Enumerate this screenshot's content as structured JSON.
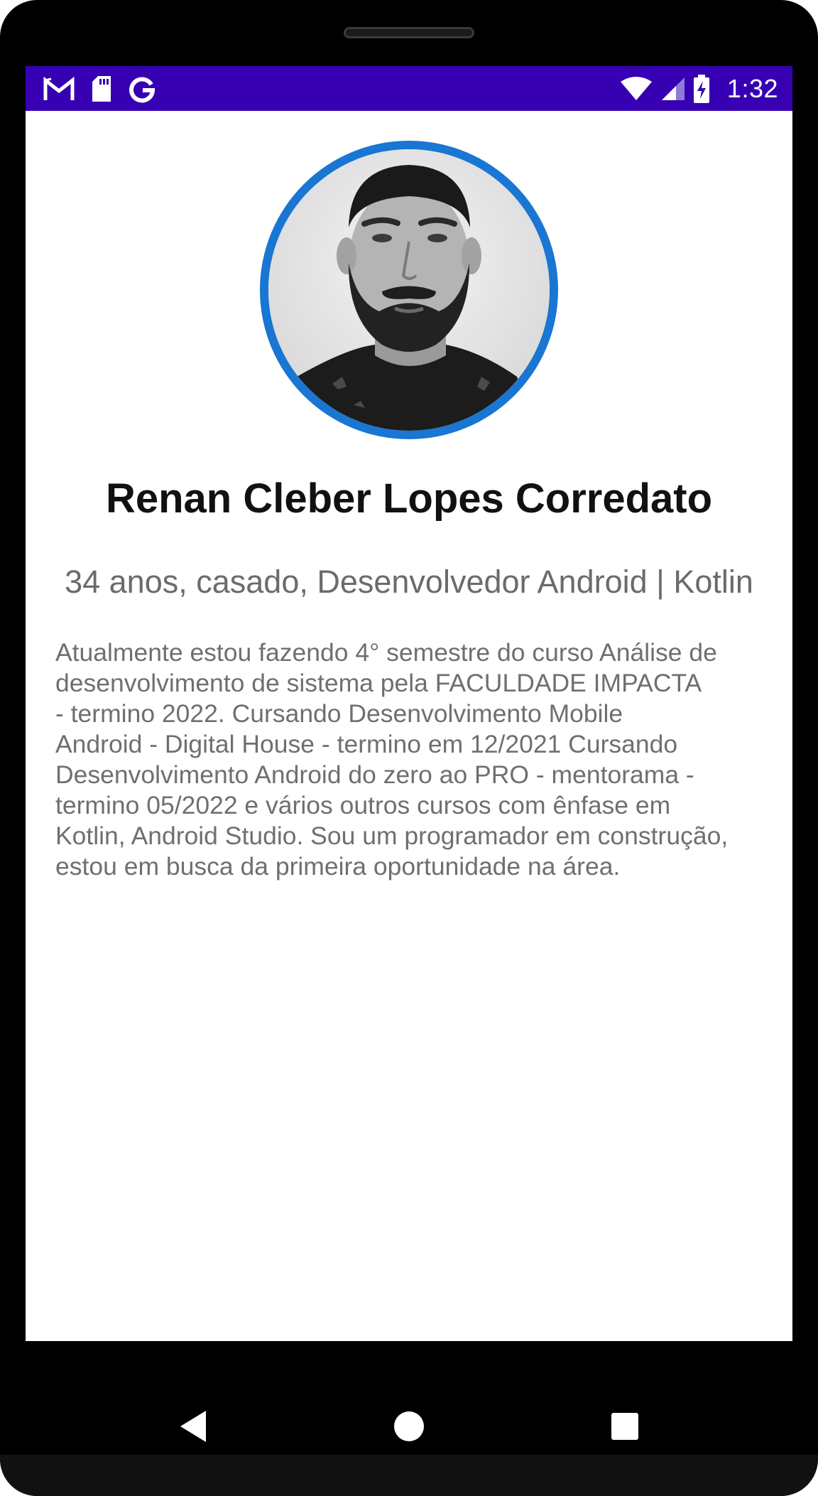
{
  "status_bar": {
    "time": "1:32",
    "left_icons": [
      "gmail-icon",
      "sd-card-icon",
      "google-icon"
    ],
    "right_icons": [
      "wifi-icon",
      "cell-signal-icon",
      "battery-charging-icon"
    ],
    "background": "#3700B3"
  },
  "profile": {
    "photo": "profile-photo",
    "name": "Renan Cleber Lopes Corredato",
    "subtitle": "34 anos, casado, Desenvolvedor Android | Kotlin",
    "bio_lines": [
      "Atualmente estou fazendo 4° semestre do curso Análise de",
      "desenvolvimento de sistema pela FACULDADE IMPACTA",
      "- termino 2022. Cursando Desenvolvimento Mobile",
      "Android - Digital House - termino em 12/2021 Cursando",
      "Desenvolvimento Android do zero ao PRO - mentorama -",
      "termino 05/2022 e vários outros cursos com ênfase em",
      "Kotlin, Android Studio. Sou um programador em construção,",
      "estou em busca da primeira oportunidade na área."
    ],
    "ring_color": "#1976D2"
  },
  "nav_bar": {
    "buttons": [
      "back-icon",
      "home-icon",
      "recents-icon"
    ]
  }
}
